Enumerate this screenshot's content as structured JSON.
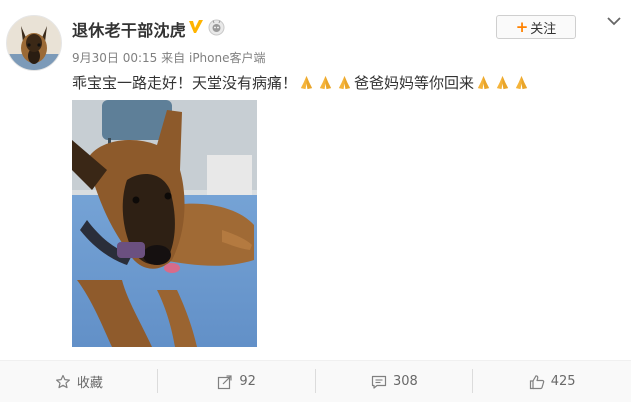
{
  "header": {
    "username": "退休老干部沈虎",
    "timestamp": "9月30日 00:15",
    "source_prefix": "来自",
    "source": "iPhone客户端",
    "follow_label": "关注",
    "verified_badge_color": "#ffb400",
    "avatar_icon": "dog-avatar"
  },
  "post": {
    "text_before": "乖宝宝一路走好！天堂没有病痛！",
    "text_middle": "爸爸妈妈等你回来",
    "emoji_name": "praying-hands-icon",
    "image_alt": "dog photo"
  },
  "actions": {
    "favorite_label": "收藏",
    "repost_count": "92",
    "comment_count": "308",
    "like_count": "425"
  }
}
